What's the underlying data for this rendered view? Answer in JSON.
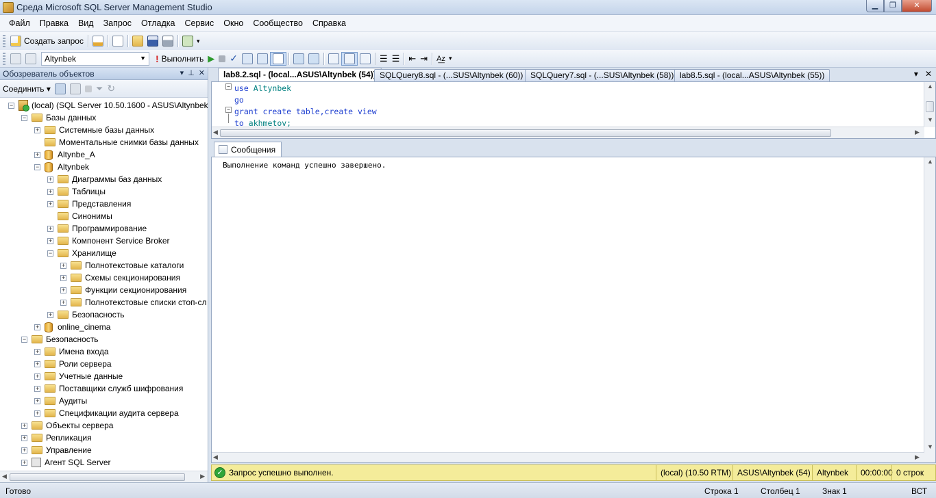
{
  "window": {
    "title": "Среда Microsoft SQL Server Management Studio"
  },
  "menu": [
    "Файл",
    "Правка",
    "Вид",
    "Запрос",
    "Отладка",
    "Сервис",
    "Окно",
    "Сообщество",
    "Справка"
  ],
  "toolbar": {
    "new_query": "Создать запрос",
    "database": "Altynbek",
    "execute": "Выполнить"
  },
  "object_explorer": {
    "title": "Обозреватель объектов",
    "connect": "Соединить",
    "tree": [
      {
        "label": "(local) (SQL Server 10.50.1600 - ASUS\\Altynbek)",
        "level": 0,
        "expand": "-",
        "icon": "server"
      },
      {
        "label": "Базы данных",
        "level": 1,
        "expand": "-",
        "icon": "folder"
      },
      {
        "label": "Системные базы данных",
        "level": 2,
        "expand": "+",
        "icon": "folder"
      },
      {
        "label": "Моментальные снимки базы данных",
        "level": 2,
        "expand": "",
        "icon": "folder"
      },
      {
        "label": "Altynbe_A",
        "level": 2,
        "expand": "+",
        "icon": "db"
      },
      {
        "label": "Altynbek",
        "level": 2,
        "expand": "-",
        "icon": "db"
      },
      {
        "label": "Диаграммы баз данных",
        "level": 3,
        "expand": "+",
        "icon": "folder"
      },
      {
        "label": "Таблицы",
        "level": 3,
        "expand": "+",
        "icon": "folder"
      },
      {
        "label": "Представления",
        "level": 3,
        "expand": "+",
        "icon": "folder"
      },
      {
        "label": "Синонимы",
        "level": 3,
        "expand": "",
        "icon": "folder"
      },
      {
        "label": "Программирование",
        "level": 3,
        "expand": "+",
        "icon": "folder"
      },
      {
        "label": "Компонент Service Broker",
        "level": 3,
        "expand": "+",
        "icon": "folder"
      },
      {
        "label": "Хранилище",
        "level": 3,
        "expand": "-",
        "icon": "folder"
      },
      {
        "label": "Полнотекстовые каталоги",
        "level": 4,
        "expand": "+",
        "icon": "folder"
      },
      {
        "label": "Схемы секционирования",
        "level": 4,
        "expand": "+",
        "icon": "folder"
      },
      {
        "label": "Функции секционирования",
        "level": 4,
        "expand": "+",
        "icon": "folder"
      },
      {
        "label": "Полнотекстовые списки стоп-сл",
        "level": 4,
        "expand": "+",
        "icon": "folder"
      },
      {
        "label": "Безопасность",
        "level": 3,
        "expand": "+",
        "icon": "folder"
      },
      {
        "label": "online_cinema",
        "level": 2,
        "expand": "+",
        "icon": "db"
      },
      {
        "label": "Безопасность",
        "level": 1,
        "expand": "-",
        "icon": "folder"
      },
      {
        "label": "Имена входа",
        "level": 2,
        "expand": "+",
        "icon": "folder"
      },
      {
        "label": "Роли сервера",
        "level": 2,
        "expand": "+",
        "icon": "folder"
      },
      {
        "label": "Учетные данные",
        "level": 2,
        "expand": "+",
        "icon": "folder"
      },
      {
        "label": "Поставщики служб шифрования",
        "level": 2,
        "expand": "+",
        "icon": "folder"
      },
      {
        "label": "Аудиты",
        "level": 2,
        "expand": "+",
        "icon": "folder"
      },
      {
        "label": "Спецификации аудита сервера",
        "level": 2,
        "expand": "+",
        "icon": "folder"
      },
      {
        "label": "Объекты сервера",
        "level": 1,
        "expand": "+",
        "icon": "folder"
      },
      {
        "label": "Репликация",
        "level": 1,
        "expand": "+",
        "icon": "folder"
      },
      {
        "label": "Управление",
        "level": 1,
        "expand": "+",
        "icon": "folder"
      },
      {
        "label": "Агент SQL Server",
        "level": 1,
        "expand": "+",
        "icon": "agent"
      }
    ]
  },
  "tabs": [
    {
      "label": "lab8.2.sql - (local...ASUS\\Altynbek (54))",
      "active": true
    },
    {
      "label": "SQLQuery8.sql - (...SUS\\Altynbek (60))",
      "active": false
    },
    {
      "label": "SQLQuery7.sql - (...SUS\\Altynbek (58))",
      "active": false
    },
    {
      "label": "lab8.5.sql - (local...ASUS\\Altynbek (55))",
      "active": false
    }
  ],
  "editor": {
    "lines": [
      [
        {
          "t": "use",
          "c": "kw"
        },
        {
          "t": " Altynbek",
          "c": "id"
        }
      ],
      [
        {
          "t": "go",
          "c": "kw"
        }
      ],
      [
        {
          "t": "grant create table,create view",
          "c": "kw"
        }
      ],
      [
        {
          "t": "to",
          "c": "kw"
        },
        {
          "t": " akhmetov;",
          "c": "id"
        }
      ]
    ]
  },
  "results": {
    "tab": "Сообщения",
    "message": "Выполнение команд успешно завершено."
  },
  "query_status": {
    "message": "Запрос успешно выполнен.",
    "server": "(local) (10.50 RTM)",
    "user": "ASUS\\Altynbek (54)",
    "database": "Altynbek",
    "time": "00:00:00",
    "rows": "0 строк"
  },
  "status": {
    "ready": "Готово",
    "line": "Строка 1",
    "column": "Столбец 1",
    "char": "Знак 1",
    "mode": "ВСТ"
  }
}
